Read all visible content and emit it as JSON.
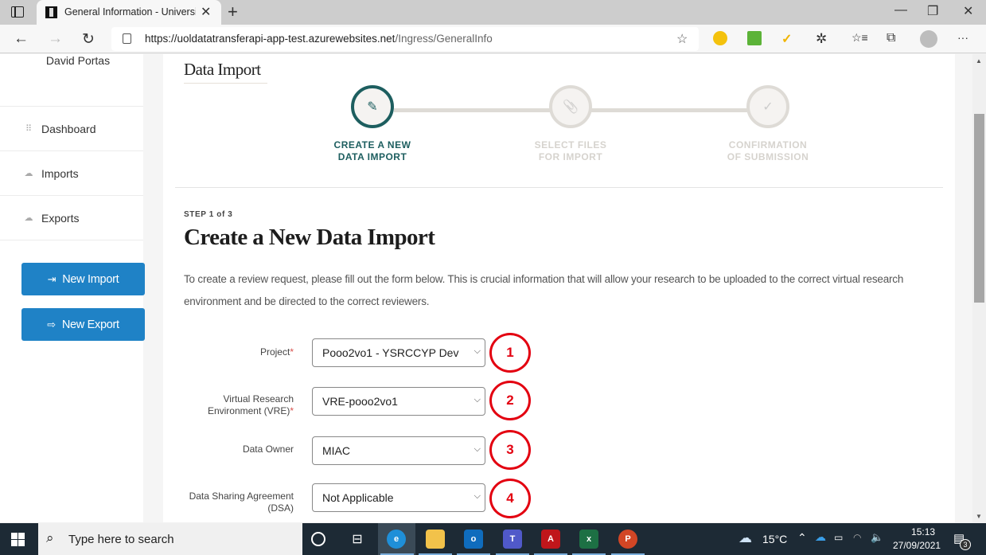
{
  "browser": {
    "tab_title": "General Information - University",
    "url_host": "https://uoldatatransferapi-app-test.azurewebsites.net",
    "url_path": "/Ingress/GeneralInfo",
    "icons": {
      "back": "←",
      "forward": "→",
      "refresh": "↻",
      "minimize": "—",
      "restore": "❐",
      "close": "✕",
      "more": "···",
      "new_tab": "+",
      "tab_close": "✕",
      "favorites_add": "☆",
      "favorites": "☆≡",
      "collections": "⧉"
    }
  },
  "sidebar": {
    "user_name": "David Portas",
    "items": [
      {
        "label": "Dashboard",
        "icon": "⠿"
      },
      {
        "label": "Imports",
        "icon": "☁"
      },
      {
        "label": "Exports",
        "icon": "☁"
      }
    ],
    "buttons": [
      {
        "label": "New Import",
        "icon": "⇥"
      },
      {
        "label": "New Export",
        "icon": "⇨"
      }
    ]
  },
  "main": {
    "page_title": "Data Import",
    "steps": [
      {
        "line1": "CREATE A NEW",
        "line2": "DATA IMPORT",
        "icon": "✎",
        "active": true
      },
      {
        "line1": "SELECT FILES",
        "line2": "FOR IMPORT",
        "icon": "📎",
        "active": false
      },
      {
        "line1": "CONFIRMATION",
        "line2": "OF SUBMISSION",
        "icon": "✓",
        "active": false
      }
    ],
    "step_count": "STEP 1 of 3",
    "heading": "Create a New Data Import",
    "intro": "To create a review request, please fill out the form below. This is crucial information that will allow your research to be uploaded to the correct virtual research environment and be directed to the correct reviewers.",
    "fields": [
      {
        "label": "Project",
        "label2": "",
        "required": "*",
        "value": "Pooo2vo1 - YSRCCYP Dev",
        "annotation": "1"
      },
      {
        "label": "Virtual Research",
        "label2": "Environment (VRE)",
        "required": "*",
        "value": "VRE-pooo2vo1",
        "annotation": "2"
      },
      {
        "label": "Data Owner",
        "label2": "",
        "required": "",
        "value": "MIAC",
        "annotation": "3"
      },
      {
        "label": "Data Sharing Agreement",
        "label2": "(DSA)",
        "required": "",
        "value": "Not Applicable",
        "annotation": "4"
      }
    ]
  },
  "taskbar": {
    "search_placeholder": "Type here to search",
    "weather": "15°C",
    "time": "15:13",
    "date": "27/09/2021",
    "notification_count": "3",
    "apps": [
      {
        "name": "Edge",
        "letter": "e",
        "color": "#1f8fd8"
      },
      {
        "name": "File Explorer",
        "letter": "",
        "color": "#f2c24a"
      },
      {
        "name": "Outlook",
        "letter": "o",
        "color": "#0f6cbd"
      },
      {
        "name": "Teams",
        "letter": "T",
        "color": "#5059c9"
      },
      {
        "name": "Acrobat",
        "letter": "A",
        "color": "#c0161b"
      },
      {
        "name": "Excel",
        "letter": "x",
        "color": "#1d7044"
      },
      {
        "name": "PowerPoint",
        "letter": "P",
        "color": "#d24625"
      }
    ]
  },
  "colors": {
    "accent": "#1f82c6",
    "step_active": "#1d5e5f",
    "annotation": "#e30010"
  }
}
